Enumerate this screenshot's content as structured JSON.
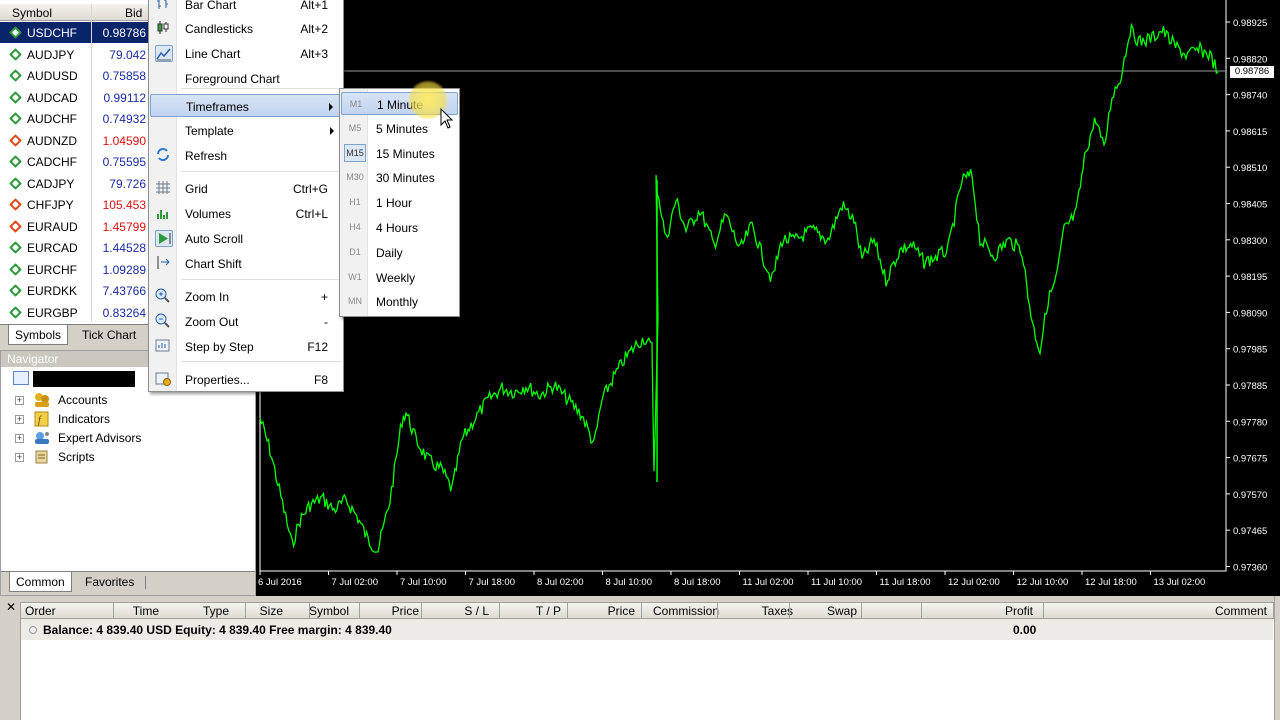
{
  "market_watch": {
    "headers": {
      "symbol": "Symbol",
      "bid": "Bid"
    },
    "rows": [
      {
        "symbol": "USDCHF",
        "bid": "0.98786",
        "dir": "up",
        "selected": true
      },
      {
        "symbol": "AUDJPY",
        "bid": "79.042",
        "dir": "up"
      },
      {
        "symbol": "AUDUSD",
        "bid": "0.75858",
        "dir": "up"
      },
      {
        "symbol": "AUDCAD",
        "bid": "0.99112",
        "dir": "up"
      },
      {
        "symbol": "AUDCHF",
        "bid": "0.74932",
        "dir": "up"
      },
      {
        "symbol": "AUDNZD",
        "bid": "1.04590",
        "dir": "down"
      },
      {
        "symbol": "CADCHF",
        "bid": "0.75595",
        "dir": "up"
      },
      {
        "symbol": "CADJPY",
        "bid": "79.726",
        "dir": "up"
      },
      {
        "symbol": "CHFJPY",
        "bid": "105.453",
        "dir": "down"
      },
      {
        "symbol": "EURAUD",
        "bid": "1.45799",
        "dir": "down"
      },
      {
        "symbol": "EURCAD",
        "bid": "1.44528",
        "dir": "up"
      },
      {
        "symbol": "EURCHF",
        "bid": "1.09289",
        "dir": "up"
      },
      {
        "symbol": "EURDKK",
        "bid": "7.43766",
        "dir": "up"
      },
      {
        "symbol": "EURGBP",
        "bid": "0.83264",
        "dir": "up"
      }
    ],
    "tabs": {
      "symbols": "Symbols",
      "tick_chart": "Tick Chart"
    }
  },
  "navigator": {
    "title": "Navigator",
    "items": [
      {
        "label": "Accounts"
      },
      {
        "label": "Indicators"
      },
      {
        "label": "Expert Advisors"
      },
      {
        "label": "Scripts"
      }
    ],
    "tabs": {
      "common": "Common",
      "favorites": "Favorites"
    }
  },
  "context_menu": {
    "items": [
      {
        "label": "Bar Chart",
        "key": "Alt+1"
      },
      {
        "label": "Candlesticks",
        "key": "Alt+2"
      },
      {
        "label": "Line Chart",
        "key": "Alt+3"
      },
      {
        "label": "Foreground Chart",
        "key": ""
      },
      {
        "label": "Timeframes",
        "key": ""
      },
      {
        "label": "Template",
        "key": ""
      },
      {
        "label": "Refresh",
        "key": ""
      },
      {
        "label": "Grid",
        "key": "Ctrl+G"
      },
      {
        "label": "Volumes",
        "key": "Ctrl+L"
      },
      {
        "label": "Auto Scroll",
        "key": ""
      },
      {
        "label": "Chart Shift",
        "key": ""
      },
      {
        "label": "Zoom In",
        "key": "+"
      },
      {
        "label": "Zoom Out",
        "key": "-"
      },
      {
        "label": "Step by Step",
        "key": "F12"
      },
      {
        "label": "Properties...",
        "key": "F8"
      }
    ]
  },
  "timeframes_menu": {
    "items": [
      {
        "code": "M1",
        "label": "1 Minute"
      },
      {
        "code": "M5",
        "label": "5 Minutes"
      },
      {
        "code": "M15",
        "label": "15 Minutes"
      },
      {
        "code": "M30",
        "label": "30 Minutes"
      },
      {
        "code": "H1",
        "label": "1 Hour"
      },
      {
        "code": "H4",
        "label": "4 Hours"
      },
      {
        "code": "D1",
        "label": "Daily"
      },
      {
        "code": "W1",
        "label": "Weekly"
      },
      {
        "code": "MN",
        "label": "Monthly"
      }
    ]
  },
  "chart": {
    "current_price": "0.98786",
    "line_color": "#00ff00",
    "y_ticks": [
      "0.98925",
      "0.98820",
      "0.98740",
      "0.98615",
      "0.98510",
      "0.98405",
      "0.98300",
      "0.98195",
      "0.98090",
      "0.97985",
      "0.97885",
      "0.97780",
      "0.97675",
      "0.97570",
      "0.97465",
      "0.97360"
    ],
    "x_ticks": [
      "6 Jul 2016",
      "7 Jul 02:00",
      "7 Jul 10:00",
      "7 Jul 18:00",
      "8 Jul 02:00",
      "8 Jul 10:00",
      "8 Jul 18:00",
      "11 Jul 02:00",
      "11 Jul 10:00",
      "11 Jul 18:00",
      "12 Jul 02:00",
      "12 Jul 10:00",
      "12 Jul 18:00",
      "13 Jul 02:00"
    ]
  },
  "terminal": {
    "columns": [
      "Order",
      "Time",
      "Type",
      "Size",
      "Symbol",
      "Price",
      "S / L",
      "T / P",
      "Price",
      "Commission",
      "Taxes",
      "Swap",
      "Profit",
      "Comment"
    ],
    "balance_text": "Balance: 4 839.40 USD  Equity: 4 839.40  Free margin: 4 839.40",
    "profit": "0.00"
  }
}
